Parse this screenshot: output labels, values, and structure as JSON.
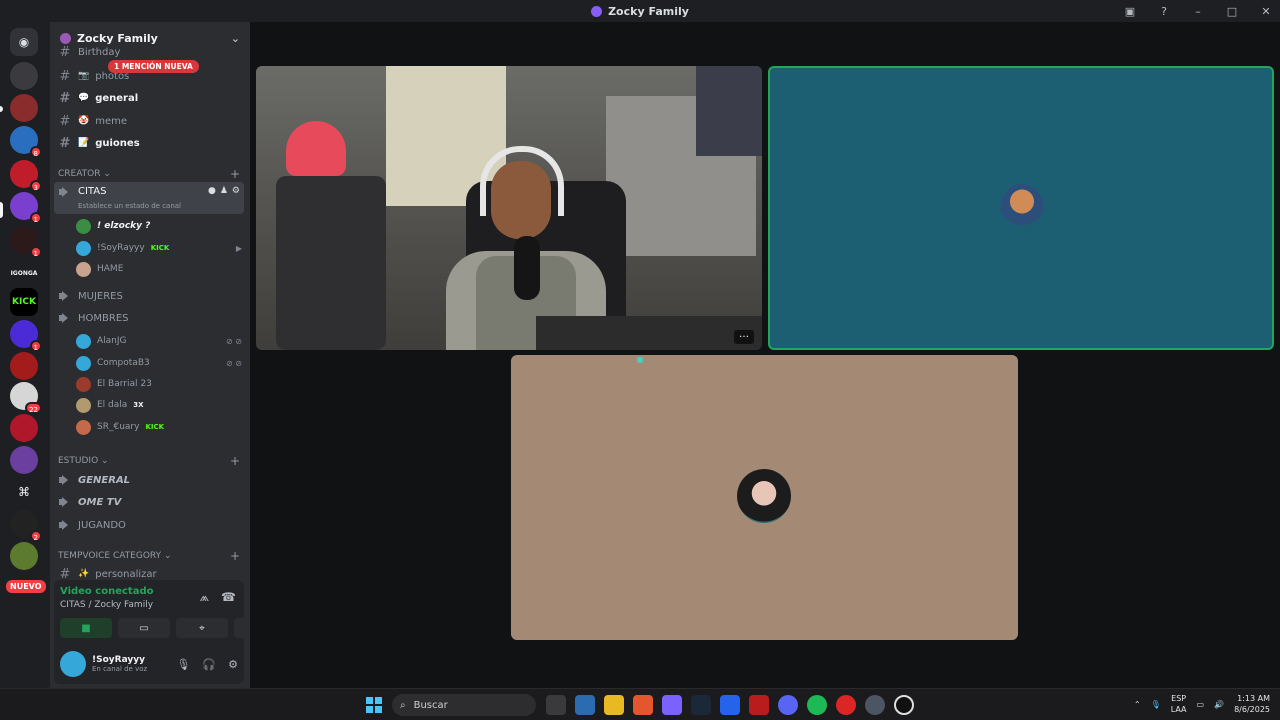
{
  "window": {
    "title": "Zocky Family"
  },
  "server": {
    "name": "Zocky Family"
  },
  "mention_banner": "1 MENCIÓN NUEVA",
  "channels_top": [
    {
      "name": "Birthday",
      "emoji": ""
    },
    {
      "name": "photos",
      "emoji": "📷"
    },
    {
      "name": "general",
      "emoji": "💬"
    },
    {
      "name": "meme",
      "emoji": "🤡"
    },
    {
      "name": "guiones",
      "emoji": "📝"
    }
  ],
  "categories": {
    "creator": "CREATOR",
    "estudio": "ESTUDIO",
    "tempvoice": "TEMPVOICE CATEGORY"
  },
  "voice_channels": {
    "citas": {
      "name": "CITAS",
      "status": "Establece un estado de canal"
    },
    "mujeres": "MUJERES",
    "hombres": "HOMBRES",
    "general": "GENERAL",
    "ometv": "OME TV",
    "jugando": "JUGANDO"
  },
  "citas_users": [
    {
      "name": "! elzocky ?",
      "color": "#3b8d43"
    },
    {
      "name": "!SoyRayyy",
      "color": "#35a7d9",
      "tag": "KICK"
    },
    {
      "name": "HAME",
      "color": "#c9a38e"
    }
  ],
  "hombres_users": [
    {
      "name": "AlanJG",
      "color": "#35a7d9"
    },
    {
      "name": "CompotaB3",
      "color": "#35a7d9"
    },
    {
      "name": "El Barrial 23",
      "color": "#9b3b2b"
    },
    {
      "name": "El dala",
      "color": "#b39a6e",
      "tag": "3X"
    },
    {
      "name": "SR_€uary",
      "color": "#c46a4b",
      "tag": "KICK"
    }
  ],
  "tempvoice_channel": {
    "name": "personalizar",
    "emoji": "✨"
  },
  "servers_badges": [
    "8",
    "3",
    "1",
    "1",
    "1",
    "22",
    "2"
  ],
  "nuevo_badge": "NUEVO",
  "connection": {
    "status": "Video conectado",
    "location": "CITAS / Zocky Family"
  },
  "user_panel": {
    "name": "!SoyRayyy",
    "status": "En canal de voz"
  },
  "taskbar": {
    "search_placeholder": "Buscar",
    "lang_line1": "ESP",
    "lang_line2": "LAA",
    "time": "1:13 AM",
    "date": "8/6/2025"
  },
  "colors": {
    "accent_green": "#23a55a",
    "teal_tile": "#1c5f73",
    "beige_tile": "#a48a75",
    "discord_red": "#f23f43"
  }
}
